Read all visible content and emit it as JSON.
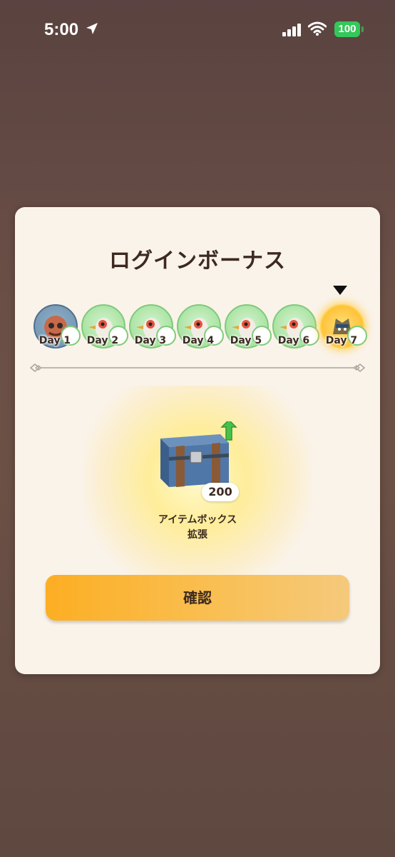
{
  "status_bar": {
    "time": "5:00",
    "battery": "100",
    "icons": [
      "location-arrow-icon",
      "cellular-signal-icon",
      "wifi-icon",
      "battery-icon"
    ]
  },
  "modal": {
    "title": "ログインボーナス",
    "days": [
      {
        "label": "Day 1",
        "state": "claimed",
        "icon": "character-portrait-icon"
      },
      {
        "label": "Day 2",
        "state": "upcoming",
        "icon": "bird-portrait-icon"
      },
      {
        "label": "Day 3",
        "state": "upcoming",
        "icon": "bird-portrait-icon"
      },
      {
        "label": "Day 4",
        "state": "upcoming",
        "icon": "bird-portrait-icon"
      },
      {
        "label": "Day 5",
        "state": "upcoming",
        "icon": "bird-portrait-icon"
      },
      {
        "label": "Day 6",
        "state": "upcoming",
        "icon": "bird-portrait-icon"
      },
      {
        "label": "Day 7",
        "state": "current",
        "icon": "monster-portrait-icon"
      }
    ],
    "reward": {
      "name_line1": "アイテムボックス",
      "name_line2": "拡張",
      "count": "200",
      "icon": "treasure-chest-icon"
    },
    "confirm_label": "確認"
  },
  "colors": {
    "background": "#6a4f46",
    "modal_bg": "#faf3ea",
    "title_text": "#3c2a20",
    "button_start": "#fcae23",
    "button_end": "#f5c97c",
    "battery_green": "#34c759",
    "day_circle_green": "#a9e3a2",
    "current_day_gold": "#ffc23a"
  }
}
